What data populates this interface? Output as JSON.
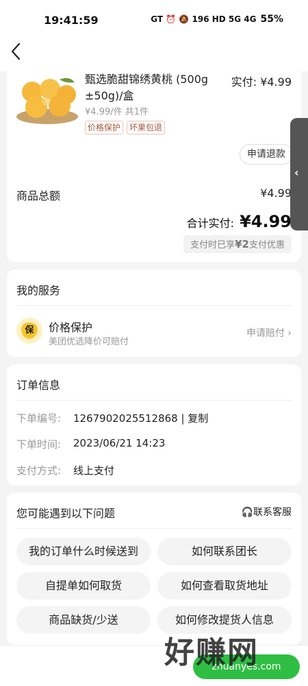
{
  "status_bar": {
    "time": "19:41:59",
    "icons_text": "GT ⏰ 🔕 196 HD 5G 4G",
    "battery": "55%"
  },
  "product": {
    "name": "甄选脆甜锦绣黄桃 (500g ±50g)/盒",
    "pay_label": "实付:",
    "pay_value": "¥4.99",
    "unit_price": "¥4.99/件",
    "qty": "共1件",
    "tags": [
      "价格保护",
      "坏果包退"
    ],
    "refund_button": "申请退款"
  },
  "summary": {
    "total_label": "商品总额",
    "total_value": "¥4.99",
    "sum_label": "合计实付:",
    "sum_value": "¥4.99",
    "discount_prefix": "支付时已享",
    "discount_amount": "¥2",
    "discount_suffix": "支付优惠"
  },
  "service": {
    "title": "我的服务",
    "badge": "保",
    "name": "价格保护",
    "desc": "美团优选降价可赔付",
    "action": "申请赔付"
  },
  "order": {
    "title": "订单信息",
    "rows": [
      {
        "label": "下单编号:",
        "value": "1267902025512868 | 复制"
      },
      {
        "label": "下单时间:",
        "value": "2023/06/21 14:23"
      },
      {
        "label": "支付方式:",
        "value": "线上支付"
      }
    ]
  },
  "issues": {
    "title": "您可能遇到以下问题",
    "contact": "联系客服",
    "buttons": [
      "我的订单什么时候送到",
      "如何联系团长",
      "自提单如何取货",
      "如何查看取货地址",
      "商品缺货/少送",
      "如何修改提货人信息"
    ]
  },
  "watermark": "好赚网",
  "bottom_button": "zhuanyes.com",
  "colors": {
    "accent_green": "#2fbe43",
    "tag_text": "#a55a3c"
  }
}
